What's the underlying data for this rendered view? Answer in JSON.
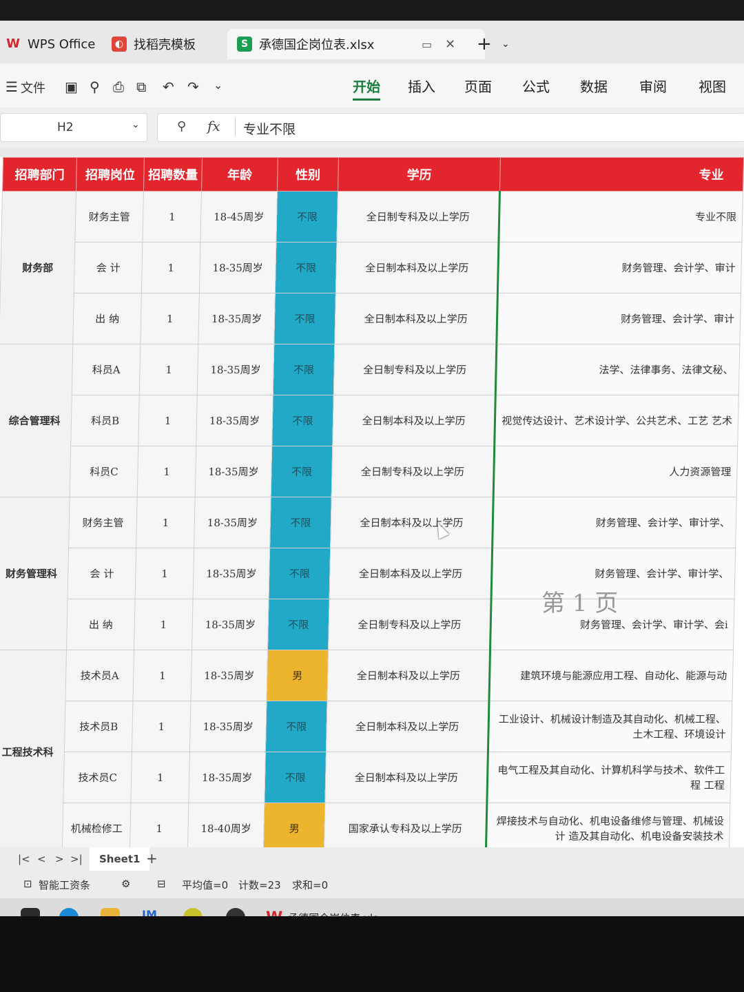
{
  "tabs": [
    {
      "label": "WPS Office",
      "icon": "wps-logo-icon"
    },
    {
      "label": "找稻壳模板",
      "icon": "docer-icon"
    },
    {
      "label": "承德国企岗位表.xlsx",
      "icon": "spreadsheet-icon",
      "active": true
    }
  ],
  "toolbar": {
    "file_label": "文件",
    "menus": [
      "开始",
      "插入",
      "页面",
      "公式",
      "数据",
      "审阅",
      "视图"
    ],
    "active_menu": "开始"
  },
  "formula_bar": {
    "cell_ref": "H2",
    "fx": "fx",
    "value": "专业不限"
  },
  "table": {
    "headers": [
      "招聘部门",
      "招聘岗位",
      "招聘数量",
      "年龄",
      "性别",
      "学历",
      "专业"
    ],
    "departments": [
      {
        "name": "财务部",
        "rows": 3
      },
      {
        "name": "综合管理科",
        "rows": 3
      },
      {
        "name": "财务管理科",
        "rows": 3
      },
      {
        "name": "工程技术科",
        "rows": 4
      }
    ],
    "rows": [
      {
        "post": "财务主管",
        "count": "1",
        "age": "18-45周岁",
        "gender": "不限",
        "edu": "全日制专科及以上学历",
        "major": "专业不限"
      },
      {
        "post": "会 计",
        "count": "1",
        "age": "18-35周岁",
        "gender": "不限",
        "edu": "全日制本科及以上学历",
        "major": "财务管理、会计学、审计"
      },
      {
        "post": "出 纳",
        "count": "1",
        "age": "18-35周岁",
        "gender": "不限",
        "edu": "全日制本科及以上学历",
        "major": "财务管理、会计学、审计"
      },
      {
        "post": "科员A",
        "count": "1",
        "age": "18-35周岁",
        "gender": "不限",
        "edu": "全日制专科及以上学历",
        "major": "法学、法律事务、法律文秘、"
      },
      {
        "post": "科员B",
        "count": "1",
        "age": "18-35周岁",
        "gender": "不限",
        "edu": "全日制本科及以上学历",
        "major": "视觉传达设计、艺术设计学、公共艺术、工艺 艺术"
      },
      {
        "post": "科员C",
        "count": "1",
        "age": "18-35周岁",
        "gender": "不限",
        "edu": "全日制专科及以上学历",
        "major": "人力资源管理"
      },
      {
        "post": "财务主管",
        "count": "1",
        "age": "18-35周岁",
        "gender": "不限",
        "edu": "全日制本科及以上学历",
        "major": "财务管理、会计学、审计学、"
      },
      {
        "post": "会 计",
        "count": "1",
        "age": "18-35周岁",
        "gender": "不限",
        "edu": "全日制本科及以上学历",
        "major": "财务管理、会计学、审计学、"
      },
      {
        "post": "出 纳",
        "count": "1",
        "age": "18-35周岁",
        "gender": "不限",
        "edu": "全日制专科及以上学历",
        "major": "财务管理、会计学、审计学、会i"
      },
      {
        "post": "技术员A",
        "count": "1",
        "age": "18-35周岁",
        "gender": "男",
        "edu": "全日制本科及以上学历",
        "major": "建筑环境与能源应用工程、自动化、能源与动"
      },
      {
        "post": "技术员B",
        "count": "1",
        "age": "18-35周岁",
        "gender": "不限",
        "edu": "全日制本科及以上学历",
        "major": "工业设计、机械设计制造及其自动化、机械工程、 土木工程、环境设计"
      },
      {
        "post": "技术员C",
        "count": "1",
        "age": "18-35周岁",
        "gender": "不限",
        "edu": "全日制本科及以上学历",
        "major": "电气工程及其自动化、计算机科学与技术、软件工程 工程"
      },
      {
        "post": "机械检修工",
        "count": "1",
        "age": "18-40周岁",
        "gender": "男",
        "edu": "国家承认专科及以上学历",
        "major": "焊接技术与自动化、机电设备维修与管理、机械设计 造及其自动化、机电设备安装技术"
      }
    ]
  },
  "watermark": "第 1 页",
  "sheetbar": {
    "sheet_name": "Sheet1",
    "add": "+"
  },
  "statusbar": {
    "smart": "智能工资条",
    "avg": "平均值=0",
    "count": "计数=23",
    "sum": "求和=0"
  },
  "taskbar": {
    "active_app": "承德国企岗位表.xls..."
  },
  "colors": {
    "header_red": "#e3262e",
    "gender_cyan": "#22a9c7",
    "gender_yellow": "#edb52e",
    "accent_green": "#1a7f3c"
  }
}
